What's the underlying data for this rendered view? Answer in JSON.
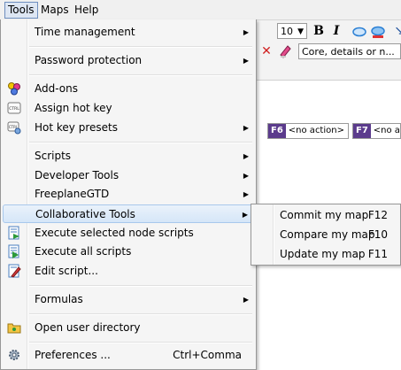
{
  "menubar": {
    "items": [
      {
        "label": "Tools"
      },
      {
        "label": "Maps"
      },
      {
        "label": "Help"
      }
    ]
  },
  "toolbar": {
    "font_size": "10",
    "bold": "B",
    "italic": "I",
    "node_style": "Core, details or n...",
    "fkeys": [
      {
        "key": "F6",
        "action": "<no action>"
      },
      {
        "key": "F7",
        "action": "<no a"
      }
    ]
  },
  "tools_menu": {
    "items": [
      {
        "label": "Time management",
        "submenu": true
      },
      {
        "label": "Password protection",
        "submenu": true
      },
      {
        "label": "Add-ons",
        "icon": "addons-icon"
      },
      {
        "label": "Assign hot key",
        "icon": "ctrl-key-icon"
      },
      {
        "label": "Hot key presets",
        "icon": "ctrl-key-settings-icon",
        "submenu": true
      },
      {
        "label": "Scripts",
        "submenu": true
      },
      {
        "label": "Developer Tools",
        "submenu": true
      },
      {
        "label": "FreeplaneGTD",
        "submenu": true
      },
      {
        "label": "Collaborative Tools",
        "submenu": true,
        "highlighted": true
      },
      {
        "label": "Execute selected node scripts",
        "icon": "execute-selected-scripts-icon"
      },
      {
        "label": "Execute all scripts",
        "icon": "execute-all-scripts-icon"
      },
      {
        "label": "Edit script...",
        "icon": "edit-script-icon"
      },
      {
        "label": "Formulas",
        "submenu": true
      },
      {
        "label": "Open user directory",
        "icon": "folder-icon"
      },
      {
        "label": "Preferences ...",
        "icon": "gear-icon",
        "accelerator": "Ctrl+Comma"
      }
    ]
  },
  "collab_submenu": {
    "items": [
      {
        "label": "Commit my map",
        "accelerator": "F12"
      },
      {
        "label": "Compare my map",
        "accelerator": "F10"
      },
      {
        "label": "Update my map",
        "accelerator": "F11"
      }
    ]
  },
  "colors": {
    "menu_bg": "#f5f5f5",
    "highlight_border": "#a8c8ec",
    "fkey_bg": "#5b3b8c"
  }
}
